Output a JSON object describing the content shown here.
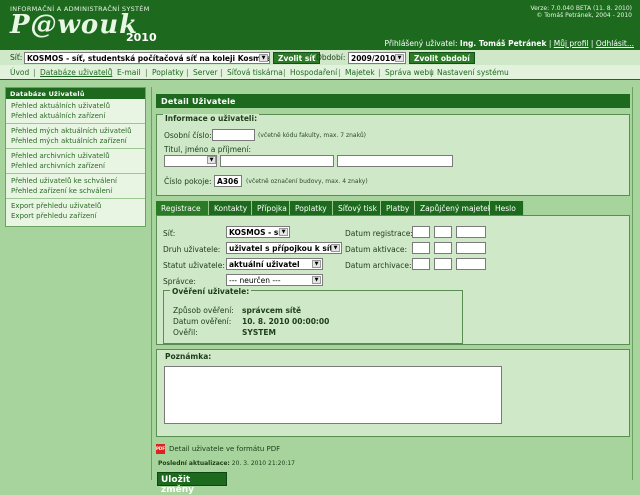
{
  "header": {
    "system_title": "INFORMAČNÍ A ADMINISTRAČNÍ SYSTÉM",
    "logo_text": "P@wouk",
    "logo_year": "2010",
    "version": "Verze: 7.0.040 BETA (11. 8. 2010)",
    "copyright": "© Tomáš Petránek, 2004 - 2010",
    "login_label": "Přihlášený uživatel:",
    "login_user": "Ing. Tomáš Petránek",
    "my_profile": "Můj profil",
    "logout": "Odhlásit..."
  },
  "netbar": {
    "net_label": "Síť:",
    "net_value": "KOSMOS - síť, studentská počítačová síť na koleji Kosmos",
    "choose_net": "Zvolit síť",
    "period_label": "Období:",
    "period_value": "2009/2010",
    "choose_period": "Zvolit období"
  },
  "menu": {
    "items": [
      "Úvod",
      "Databáze uživatelů",
      "E-mail",
      "Poplatky",
      "Server",
      "Síťová tiskárna",
      "Hospodaření",
      "Majetek",
      "Správa webu",
      "Nastavení systému"
    ]
  },
  "sidebar": {
    "title": "Databáze Uživatelů",
    "groups": [
      [
        "Přehled aktuálních uživatelů",
        "Přehled aktuálních zařízení"
      ],
      [
        "Přehled mých aktuálních uživatelů",
        "Přehled mých aktuálních zařízení"
      ],
      [
        "Přehled archivních uživatelů",
        "Přehled archivních zařízení"
      ],
      [
        "Přehled uživatelů ke schválení",
        "Přehled zařízení ke schválení"
      ],
      [
        "Export přehledu uživatelů",
        "Export přehledu zařízení"
      ]
    ]
  },
  "detail": {
    "title": "Detail Uživatele",
    "info_legend": "Informace o uživateli:",
    "personal_no_label": "Osobní číslo:",
    "personal_no_value": "",
    "personal_no_hint": "(včetně kódu fakulty, max. 7 znaků)",
    "name_label": "Titul, jméno a příjmení:",
    "room_label": "Číslo pokoje:",
    "room_value": "A306",
    "room_hint": "(včetně označení budovy, max. 4 znaky)"
  },
  "tabs": [
    "Registrace",
    "Kontakty",
    "Přípojka",
    "Poplatky",
    "Síťový tisk",
    "Platby",
    "Zapůjčený majetek",
    "Heslo"
  ],
  "registration": {
    "net_label": "Síť:",
    "net_value": "KOSMOS - síť",
    "type_label": "Druh uživatele:",
    "type_value": "uživatel s přípojkou k síti",
    "status_label": "Statut uživatele:",
    "status_value": "aktuální uživatel",
    "admin_label": "Správce:",
    "admin_value": "--- neurčen ---",
    "reg_date_label": "Datum registrace:",
    "act_date_label": "Datum aktivace:",
    "arch_date_label": "Datum archivace:",
    "verify_legend": "Ověření uživatele:",
    "verify_method_label": "Způsob ověření:",
    "verify_method_value": "správcem sítě",
    "verify_date_label": "Datum ověření:",
    "verify_date_value": "10. 8. 2010  00:00:00",
    "verified_by_label": "Ověřil:",
    "verified_by_value": "SYSTEM"
  },
  "note": {
    "legend": "Poznámka:"
  },
  "footer": {
    "pdf_link": "Detail uživatele ve formátu PDF",
    "last_update_label": "Poslední aktualizace:",
    "last_update_value": "20. 3. 2010  21:20:17",
    "save_button": "Uložit změny"
  }
}
